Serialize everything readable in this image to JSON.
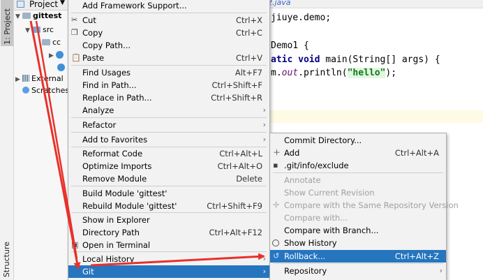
{
  "sidebar": {
    "project_tab": "1: Project",
    "structure_tab": "Structure"
  },
  "project_panel": {
    "header": "Project",
    "tree": [
      {
        "label": "gittest"
      },
      {
        "label": "src"
      },
      {
        "label": "cc"
      },
      {
        "label": "External"
      },
      {
        "label": "Scratches"
      }
    ]
  },
  "editor": {
    "tab": "2.java",
    "lines": {
      "l1": "jiuye.demo;",
      "l2": "Demo1 {",
      "l3_kw": "atic void",
      "l3_rest": " main(String[] args) {",
      "l4_pre": "m.",
      "l4_fld": "out",
      "l4_mid": ".println(",
      "l4_str": "\"hello\"",
      "l4_end": ");"
    }
  },
  "context_menu": {
    "items": {
      "add_framework": "Add Framework Support...",
      "cut": "Cut",
      "cut_sc": "Ctrl+X",
      "copy": "Copy",
      "copy_sc": "Ctrl+C",
      "copy_path": "Copy Path...",
      "paste": "Paste",
      "paste_sc": "Ctrl+V",
      "find_usages": "Find Usages",
      "find_usages_sc": "Alt+F7",
      "find_in_path": "Find in Path...",
      "find_in_path_sc": "Ctrl+Shift+F",
      "replace_in_path": "Replace in Path...",
      "replace_in_path_sc": "Ctrl+Shift+R",
      "analyze": "Analyze",
      "refactor": "Refactor",
      "add_to_favorites": "Add to Favorites",
      "reformat_code": "Reformat Code",
      "reformat_code_sc": "Ctrl+Alt+L",
      "optimize_imports": "Optimize Imports",
      "optimize_imports_sc": "Ctrl+Alt+O",
      "remove_module": "Remove Module",
      "remove_module_sc": "Delete",
      "build_module": "Build Module 'gittest'",
      "rebuild_module": "Rebuild Module 'gittest'",
      "rebuild_module_sc": "Ctrl+Shift+F9",
      "show_in_explorer": "Show in Explorer",
      "directory_path": "Directory Path",
      "directory_path_sc": "Ctrl+Alt+F12",
      "open_in_terminal": "Open in Terminal",
      "local_history": "Local History",
      "git": "Git"
    }
  },
  "git_submenu": {
    "items": {
      "commit_directory": "Commit Directory...",
      "add": "Add",
      "add_sc": "Ctrl+Alt+A",
      "gitinfo_exclude": ".git/info/exclude",
      "annotate": "Annotate",
      "show_current_revision": "Show Current Revision",
      "compare_same_repo": "Compare with the Same Repository Version",
      "compare_with": "Compare with...",
      "compare_with_branch": "Compare with Branch...",
      "show_history": "Show History",
      "rollback": "Rollback...",
      "rollback_sc": "Ctrl+Alt+Z",
      "repository": "Repository"
    }
  },
  "colors": {
    "selection": "#2675bf",
    "annotation_arrow": "#e8312a"
  }
}
